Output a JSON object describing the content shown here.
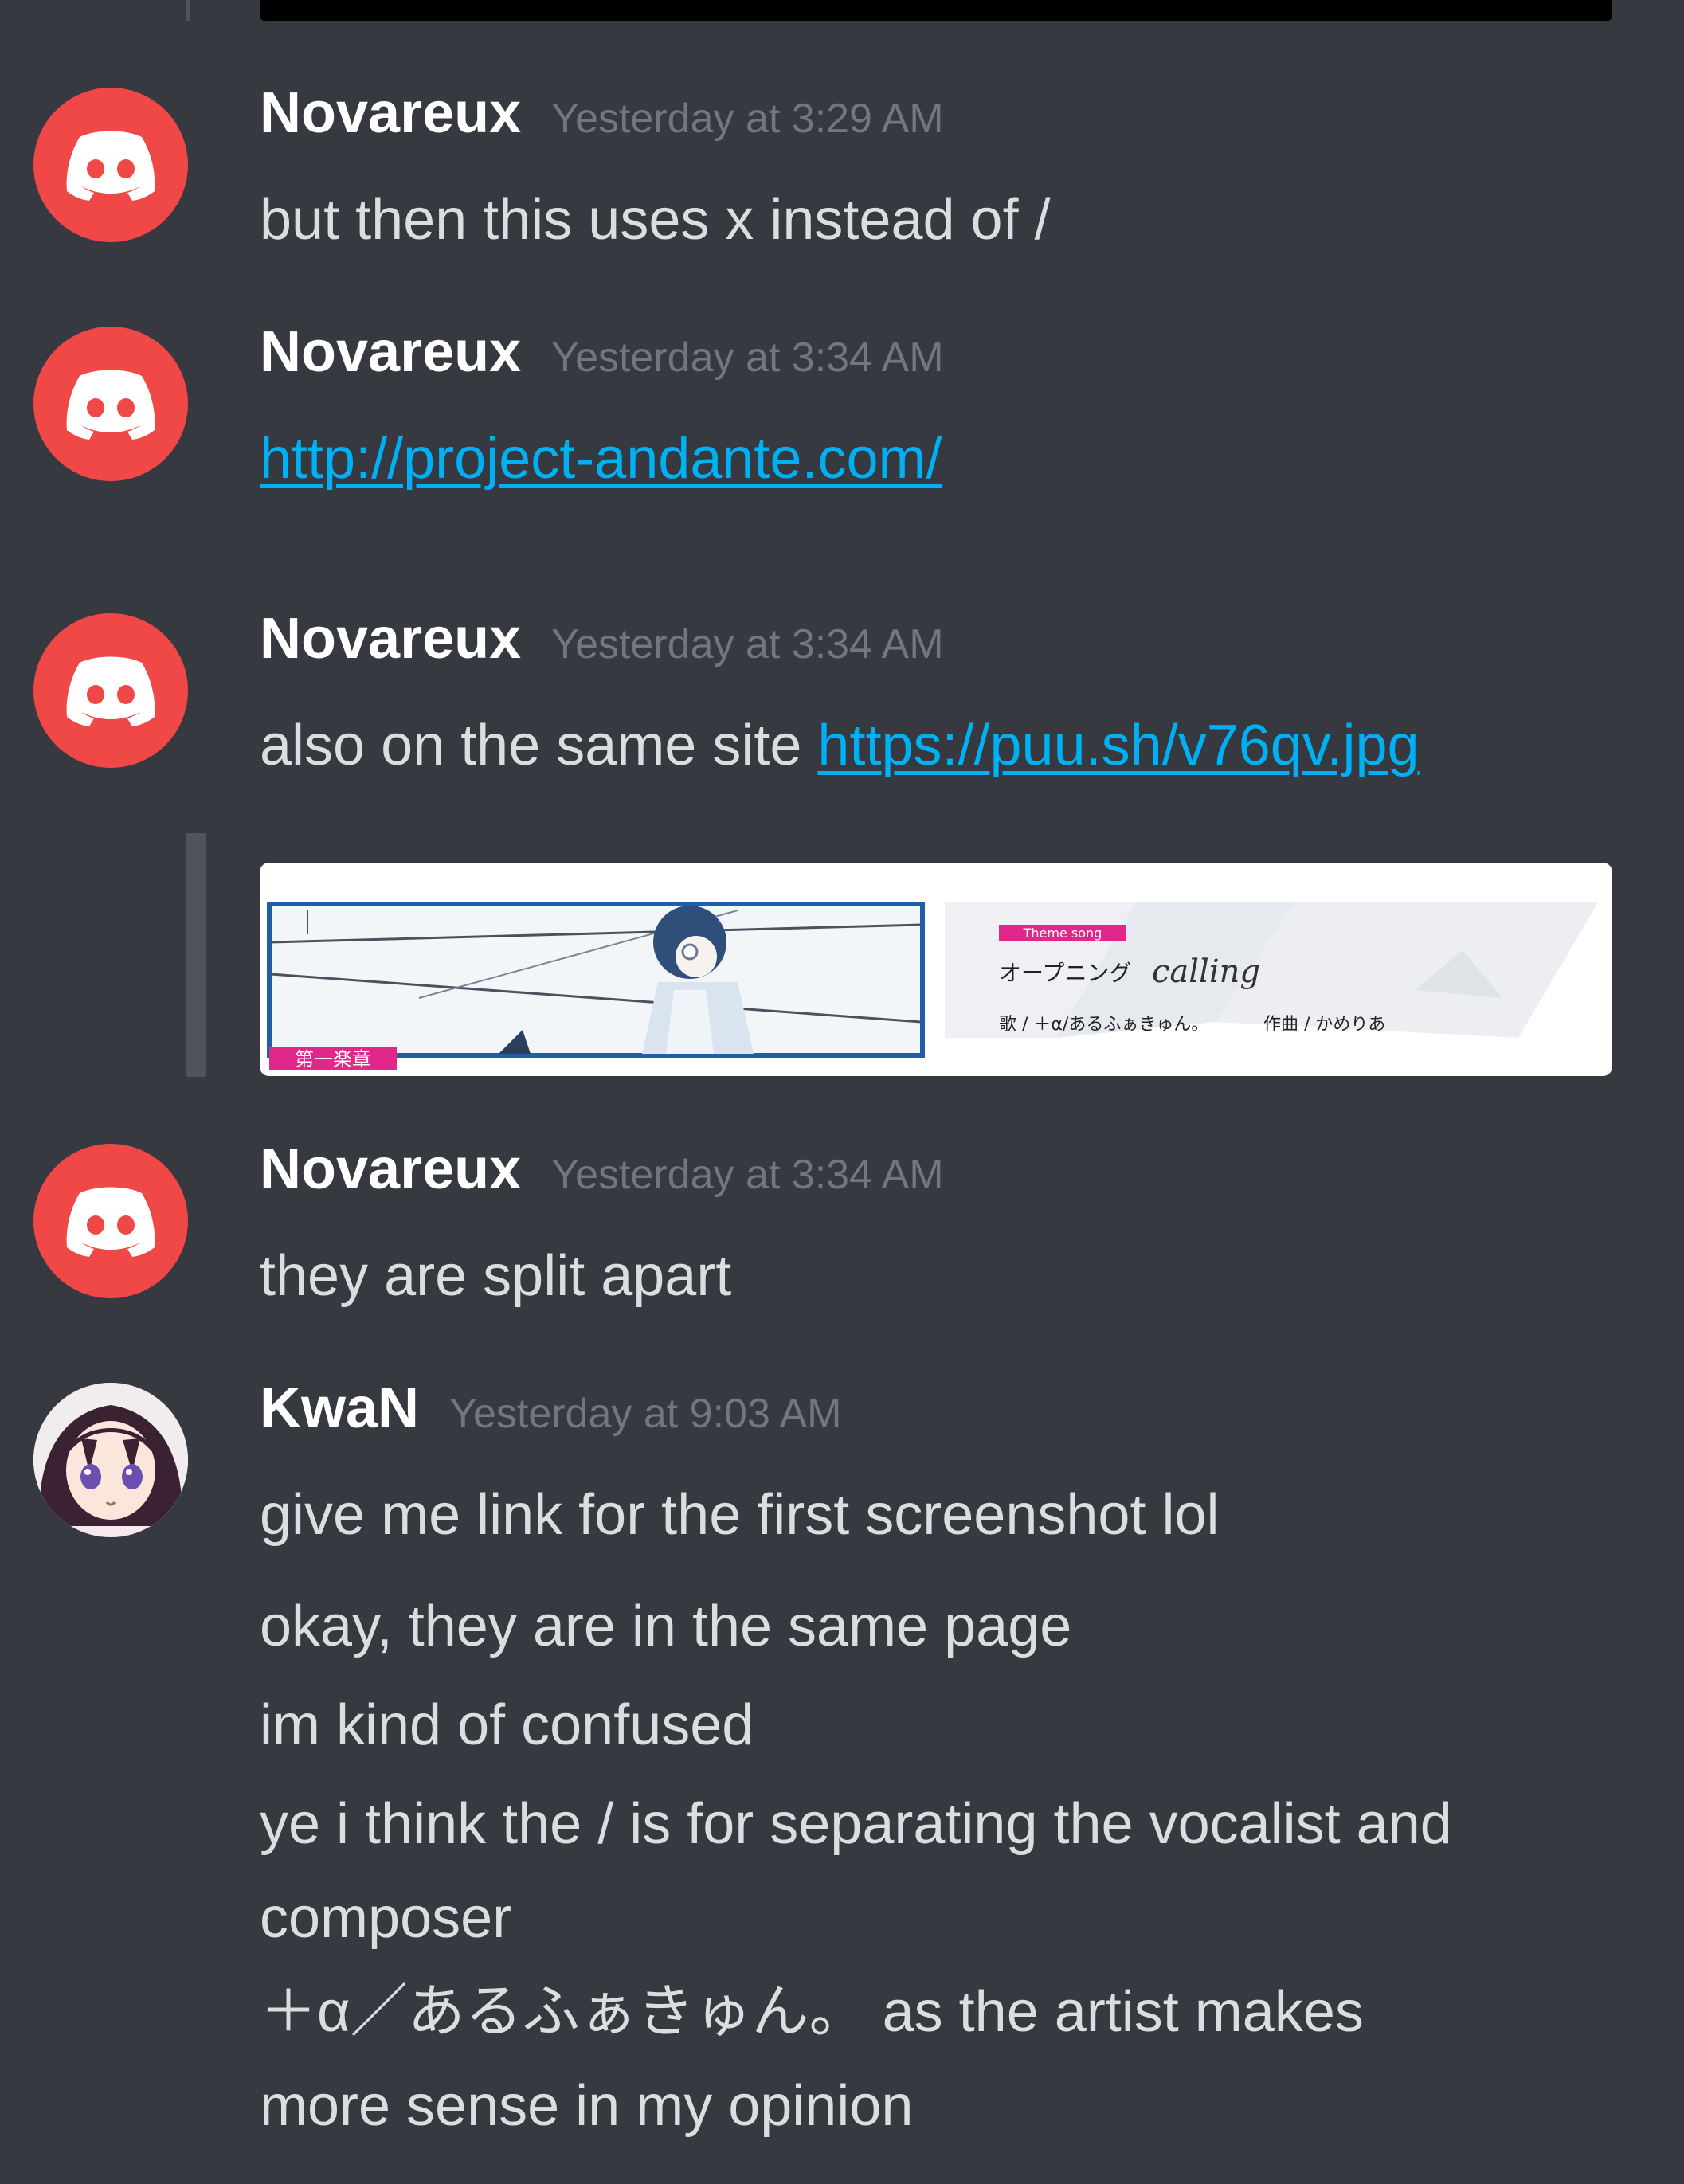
{
  "messages": [
    {
      "username": "Novareux",
      "timestamp": "Yesterday at 3:29 AM",
      "lines": [
        "but then this uses x instead of /"
      ]
    },
    {
      "username": "Novareux",
      "timestamp": "Yesterday at 3:34 AM",
      "link": "http://project-andante.com/"
    },
    {
      "username": "Novareux",
      "timestamp": "Yesterday at 3:34 AM",
      "text": "also on the same site",
      "link": "https://puu.sh/v76qv.jpg",
      "embed": {
        "theme_label": "Theme song",
        "opening_label": "オープニング",
        "song_title": "calling",
        "credits": "歌 / ＋α/あるふぁきゅん。",
        "composer": "作曲 / かめりあ",
        "episode_label": "第一楽章"
      }
    },
    {
      "username": "Novareux",
      "timestamp": "Yesterday at 3:34 AM",
      "lines": [
        "they are split apart"
      ]
    },
    {
      "username": "KwaN",
      "timestamp": "Yesterday at 9:03 AM",
      "lines": [
        "give me link for the first screenshot lol",
        "okay, they are in the same page",
        "im kind of confused",
        "ye i think the / is for separating the vocalist and",
        "composer",
        "＋α／あるふぁきゅん。 as the artist makes",
        "more sense in my opinion"
      ]
    }
  ],
  "colors": {
    "background": "#36393f",
    "username": "#ffffff",
    "timestamp": "#72767d",
    "text": "#dcddde",
    "link": "#00b0f4",
    "discord_avatar": "#f04747",
    "embed_bar": "#4f545c"
  }
}
